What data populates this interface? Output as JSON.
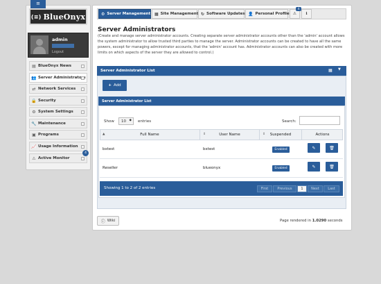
{
  "logo": {
    "text": "BlueOnyx",
    "mark": "(≡)",
    "ribbon": "≡"
  },
  "user": {
    "name": "admin",
    "logout": "Logout"
  },
  "sidebar": {
    "items": [
      {
        "label": "BlueOnyx News",
        "icon": "news-icon",
        "glyph": "▤"
      },
      {
        "label": "Server Administrators",
        "icon": "users-icon",
        "glyph": "👥"
      },
      {
        "label": "Network Services",
        "icon": "network-icon",
        "glyph": "⇄"
      },
      {
        "label": "Security",
        "icon": "lock-icon",
        "glyph": "🔒"
      },
      {
        "label": "System Settings",
        "icon": "gear-icon",
        "glyph": "⚙"
      },
      {
        "label": "Maintenance",
        "icon": "wrench-icon",
        "glyph": "🔧"
      },
      {
        "label": "Programs",
        "icon": "programs-icon",
        "glyph": "▣"
      },
      {
        "label": "Usage Information",
        "icon": "chart-icon",
        "glyph": "📈"
      },
      {
        "label": "Active Monitor",
        "icon": "monitor-icon",
        "glyph": "⚠"
      }
    ],
    "badge": "4"
  },
  "tabs": [
    {
      "label": "Server Management",
      "glyph": "⚙"
    },
    {
      "label": "Site Management",
      "glyph": "▦"
    },
    {
      "label": "Software Updates",
      "glyph": "↻"
    },
    {
      "label": "Personal Profile",
      "glyph": "👤"
    }
  ],
  "tab_icons": {
    "warning": "⚠",
    "warning_badge": "4",
    "info": "ℹ"
  },
  "page": {
    "title": "Server Administrators",
    "description": "(Create and manage server administrator accounts. Creating separate server administrator accounts other than the 'admin' account allows the system administrator to allow trusted third parties to manage the server. Administrator accounts can be created to have all the same powers, except for managing administrator accounts, that the 'admin' account has. Administrator accounts can also be created with more limits on which aspects of the server they are allowed to control.)"
  },
  "list_panel": {
    "title": "Server Administrator List",
    "add_label": "Add",
    "grid_glyph": "▦",
    "caret_glyph": "▼"
  },
  "table_panel": {
    "title": "Server Administrator List",
    "show_label": "Show",
    "page_size": "10",
    "entries_label": "entries",
    "search_label": "Search:",
    "columns": [
      "Full Name",
      "User Name",
      "Suspended",
      "Actions"
    ],
    "rows": [
      {
        "full_name": "bxtest",
        "user_name": "bxtest",
        "suspended": "Enabled"
      },
      {
        "full_name": "Reseller",
        "user_name": "blueonyx",
        "suspended": "Enabled"
      }
    ],
    "showing": "Showing 1 to 2 of 2 entries",
    "pagination": {
      "first": "First",
      "previous": "Previous",
      "current": "1",
      "next": "Next",
      "last": "Last"
    }
  },
  "footer": {
    "wiki": "Wiki",
    "rendered_prefix": "Page rendered in",
    "rendered_time": "1.0290",
    "rendered_suffix": "seconds"
  },
  "colors": {
    "accent": "#2a5d9a",
    "background": "#d9d9d9"
  }
}
